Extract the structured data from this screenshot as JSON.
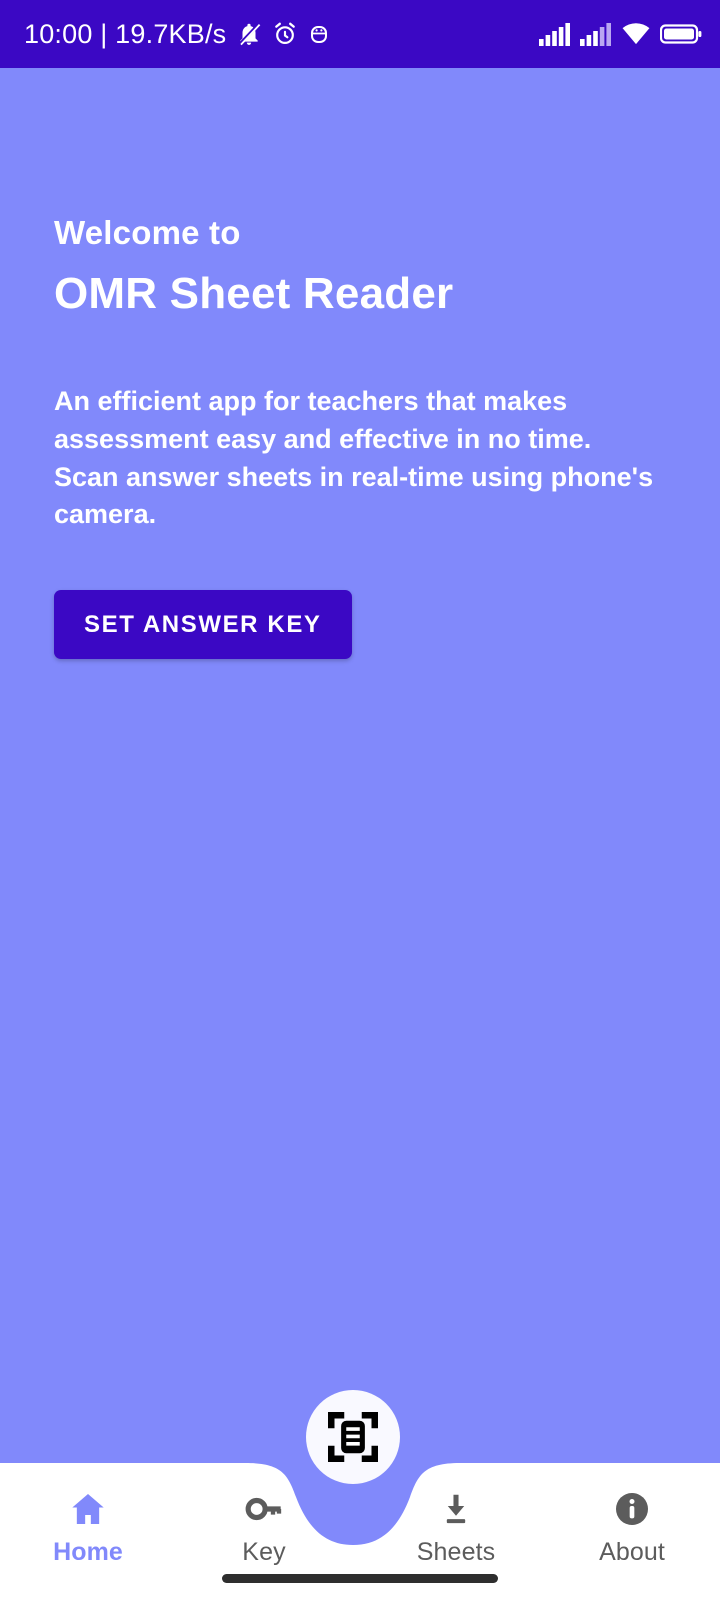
{
  "status_bar": {
    "clock": "10:00 | 19.7KB/s",
    "left_icons": [
      "bell-muted-icon",
      "alarm-clock-icon",
      "android-robot-icon"
    ],
    "right_icons": [
      "signal-bars-icon",
      "signal-bars-secondary-icon",
      "wifi-icon",
      "battery-icon"
    ],
    "background": "#3B08C4",
    "foreground": "#FFFFFF"
  },
  "hero": {
    "welcome_label": "Welcome to",
    "app_title": "OMR Sheet Reader",
    "description": "An efficient app for teachers that makes assessment easy and effective in no time. Scan answer sheets in real-time using phone's camera.",
    "primary_button_label": "SET ANSWER KEY",
    "background": "#8189FB",
    "button_color": "#3B08C4",
    "text_color": "#FFFFFF"
  },
  "fab": {
    "icon": "document-scanner-icon",
    "background": "#F9F9FF",
    "icon_color": "#000000"
  },
  "bottom_nav": {
    "background": "#FFFFFF",
    "active_color": "#8189FB",
    "inactive_color": "#5C5C5C",
    "items": [
      {
        "label": "Home",
        "icon": "home-icon",
        "active": true
      },
      {
        "label": "Key",
        "icon": "key-icon",
        "active": false
      },
      {
        "label": "Sheets",
        "icon": "download-icon",
        "active": false
      },
      {
        "label": "About",
        "icon": "info-icon",
        "active": false
      }
    ]
  },
  "system": {
    "gesture_bar_color": "#2E2E2E"
  }
}
